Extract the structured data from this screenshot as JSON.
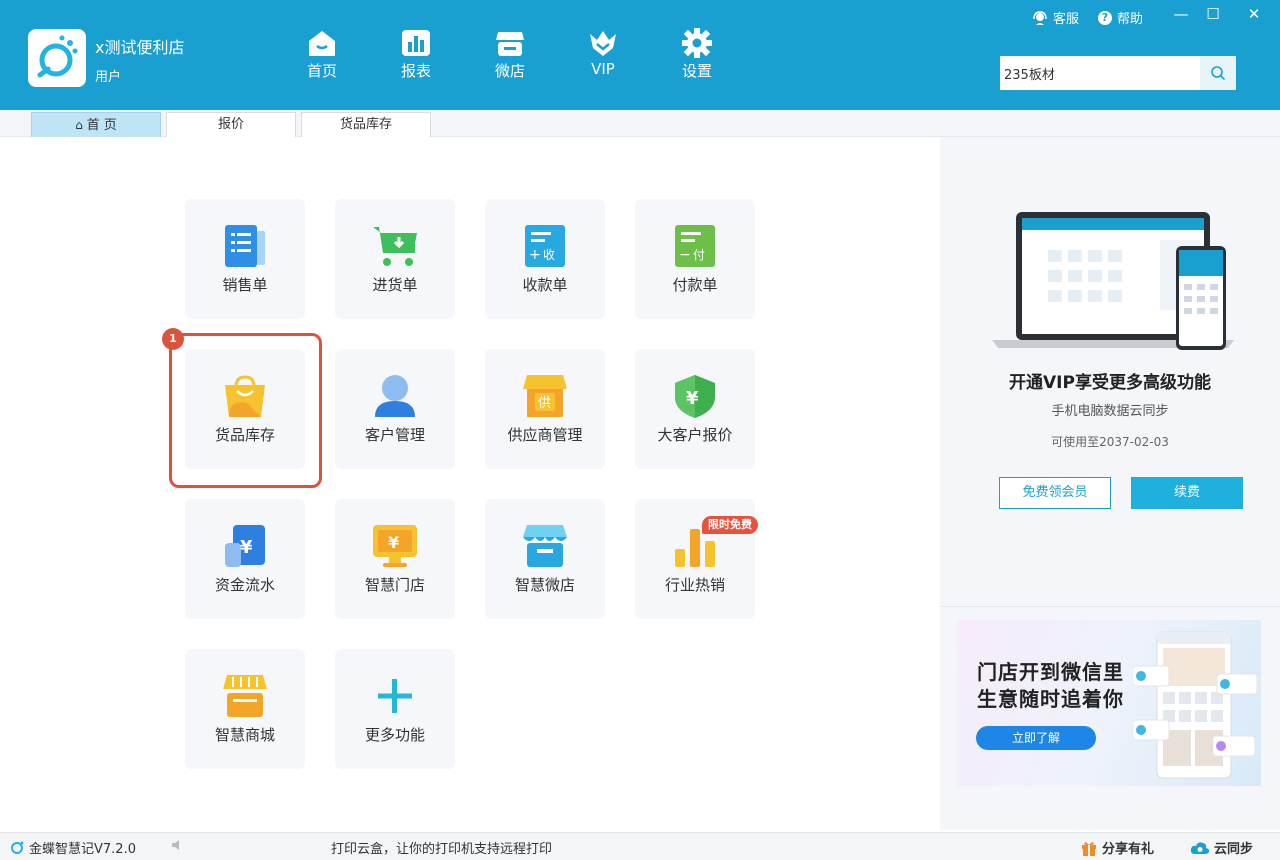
{
  "header": {
    "store_name": "x测试便利店",
    "store_role": "用户",
    "nav": [
      {
        "label": "首页",
        "icon": "home-icon"
      },
      {
        "label": "报表",
        "icon": "report-icon"
      },
      {
        "label": "微店",
        "icon": "shop-icon"
      },
      {
        "label": "VIP",
        "icon": "vip-crown-icon"
      },
      {
        "label": "设置",
        "icon": "gear-icon"
      }
    ],
    "customer_service": "客服",
    "help": "帮助",
    "search_value": "235板材",
    "window_controls": [
      "—",
      "☐",
      "✕"
    ]
  },
  "tabs": [
    {
      "label": "首 页",
      "active": true
    },
    {
      "label": "报价",
      "active": false
    },
    {
      "label": "货品库存",
      "active": false
    }
  ],
  "tiles": [
    {
      "label": "销售单",
      "icon": "sales-order-icon"
    },
    {
      "label": "进货单",
      "icon": "purchase-cart-icon"
    },
    {
      "label": "收款单",
      "icon": "receipt-icon",
      "icon_text": "收"
    },
    {
      "label": "付款单",
      "icon": "payment-icon",
      "icon_text": "付"
    },
    {
      "label": "货品库存",
      "icon": "shopping-bag-icon"
    },
    {
      "label": "客户管理",
      "icon": "customer-icon"
    },
    {
      "label": "供应商管理",
      "icon": "supplier-icon",
      "icon_text": "供"
    },
    {
      "label": "大客户报价",
      "icon": "shield-yen-icon",
      "icon_text": "¥"
    },
    {
      "label": "资金流水",
      "icon": "cashflow-icon",
      "icon_text": "¥"
    },
    {
      "label": "智慧门店",
      "icon": "smart-store-icon",
      "icon_text": "¥"
    },
    {
      "label": "智慧微店",
      "icon": "smart-microstore-icon"
    },
    {
      "label": "行业热销",
      "icon": "bar-chart-icon",
      "badge": "限时免费"
    },
    {
      "label": "智慧商城",
      "icon": "mall-icon"
    },
    {
      "label": "更多功能",
      "icon": "plus-icon"
    }
  ],
  "highlight_number": "1",
  "vip": {
    "title": "开通VIP享受更多高级功能",
    "subtitle": "手机电脑数据云同步",
    "expiry": "可使用至2037-02-03",
    "free_button": "免费领会员",
    "renew_button": "续费"
  },
  "banner": {
    "line1": "门店开到微信里",
    "line2": "生意随时追着你",
    "button": "立即了解"
  },
  "status": {
    "version": "金蝶智慧记V7.2.0",
    "message": "打印云盒，让你的打印机支持远程打印",
    "share": "分享有礼",
    "sync": "云同步"
  },
  "colors": {
    "header_bg": "#1a9fd1",
    "accent": "#1fb0de",
    "highlight": "#d9543a",
    "badge": "#e8523c"
  }
}
